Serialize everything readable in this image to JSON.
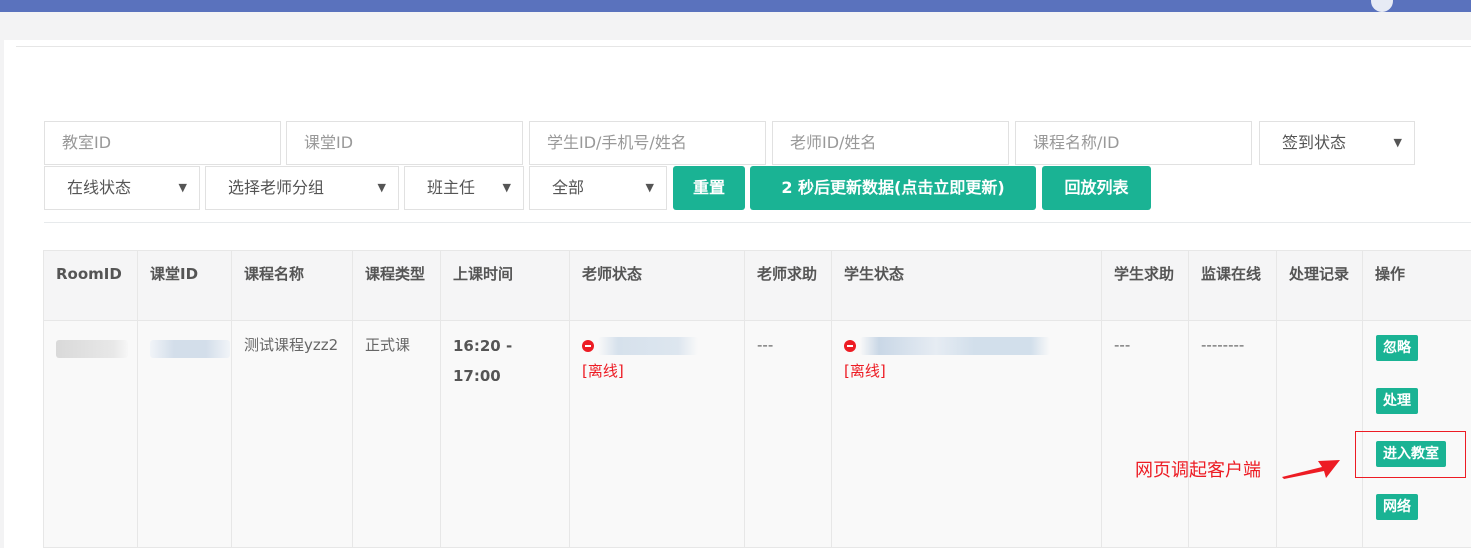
{
  "filters": {
    "row1": [
      {
        "placeholder": "教室ID"
      },
      {
        "placeholder": "课堂ID"
      },
      {
        "placeholder": "学生ID/手机号/姓名"
      },
      {
        "placeholder": "老师ID/姓名"
      },
      {
        "placeholder": "课程名称/ID"
      }
    ],
    "checkin_select": "签到状态",
    "online_select": "在线状态",
    "teacher_group_select": "选择老师分组",
    "head_teacher_select": "班主任",
    "scope_select": "全部",
    "reset_label": "重置",
    "refresh_label": "2 秒后更新数据(点击立即更新)",
    "playback_label": "回放列表"
  },
  "table": {
    "headers": [
      "RoomID",
      "课堂ID",
      "课程名称",
      "课程类型",
      "上课时间",
      "老师状态",
      "老师求助",
      "学生状态",
      "学生求助",
      "监课在线",
      "处理记录",
      "操作"
    ],
    "row": {
      "course_name": "测试课程yzz2",
      "course_type": "正式课",
      "time": "16:20 - 17:00",
      "teacher_status": "[离线]",
      "teacher_help": "---",
      "student_status": "[离线]",
      "student_help": "---",
      "monitor_online": "--------",
      "record": "",
      "actions": [
        "忽略",
        "处理",
        "进入教室",
        "网络"
      ]
    }
  },
  "annotation": "网页调起客户端",
  "colors": {
    "primary": "#1ab394",
    "topbar": "#5a72bd",
    "alert": "#ed1c24"
  }
}
